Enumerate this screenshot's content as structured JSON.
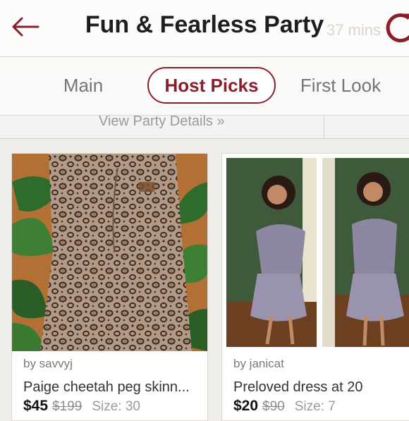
{
  "header": {
    "title": "Fun & Fearless Party",
    "ghost_text": "37 mins"
  },
  "tabs": [
    {
      "label": "Main",
      "active": false
    },
    {
      "label": "Host Picks",
      "active": true
    },
    {
      "label": "First Look",
      "active": false
    }
  ],
  "details": {
    "link_label": "View Party Details »"
  },
  "listings": [
    {
      "seller": "by savvyj",
      "title": "Paige cheetah peg skinn...",
      "price": "$45",
      "original_price": "$199",
      "size": "Size: 30"
    },
    {
      "seller": "by janicat",
      "title": "Preloved dress at 20",
      "price": "$20",
      "original_price": "$90",
      "size": "Size: 7"
    }
  ],
  "colors": {
    "accent": "#8a1f2c",
    "background": "#eeede9"
  },
  "icons": {
    "back": "back-arrow-icon",
    "refresh": "refresh-icon"
  }
}
